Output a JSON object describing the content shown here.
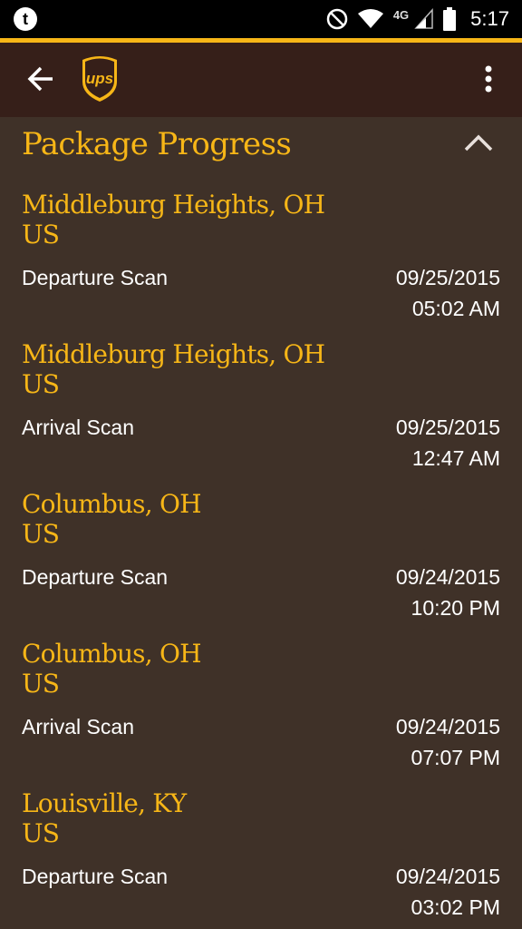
{
  "colors": {
    "accent": "#f7b617",
    "app_bar": "#361f19",
    "background": "#3f3128",
    "text_light": "#ffffff"
  },
  "status_bar": {
    "time": "5:17",
    "network": "4G",
    "icons": [
      "t-notification-icon",
      "do-not-disturb-icon",
      "wifi-icon",
      "signal-icon",
      "battery-icon"
    ]
  },
  "app_bar": {
    "logo_text": "ups",
    "icons": [
      "back-arrow-icon",
      "ups-logo",
      "more-vert-icon"
    ]
  },
  "section": {
    "title": "Package Progress",
    "collapse_icon": "chevron-up-icon"
  },
  "events": [
    {
      "city": "Middleburg Heights, OH",
      "country": "US",
      "status": "Departure Scan",
      "date": "09/25/2015",
      "time": "05:02 AM"
    },
    {
      "city": "Middleburg Heights, OH",
      "country": "US",
      "status": "Arrival Scan",
      "date": "09/25/2015",
      "time": "12:47 AM"
    },
    {
      "city": "Columbus, OH",
      "country": "US",
      "status": "Departure Scan",
      "date": "09/24/2015",
      "time": "10:20 PM"
    },
    {
      "city": "Columbus, OH",
      "country": "US",
      "status": "Arrival Scan",
      "date": "09/24/2015",
      "time": "07:07 PM"
    },
    {
      "city": "Louisville, KY",
      "country": "US",
      "status": "Departure Scan",
      "date": "09/24/2015",
      "time": "03:02 PM"
    }
  ]
}
